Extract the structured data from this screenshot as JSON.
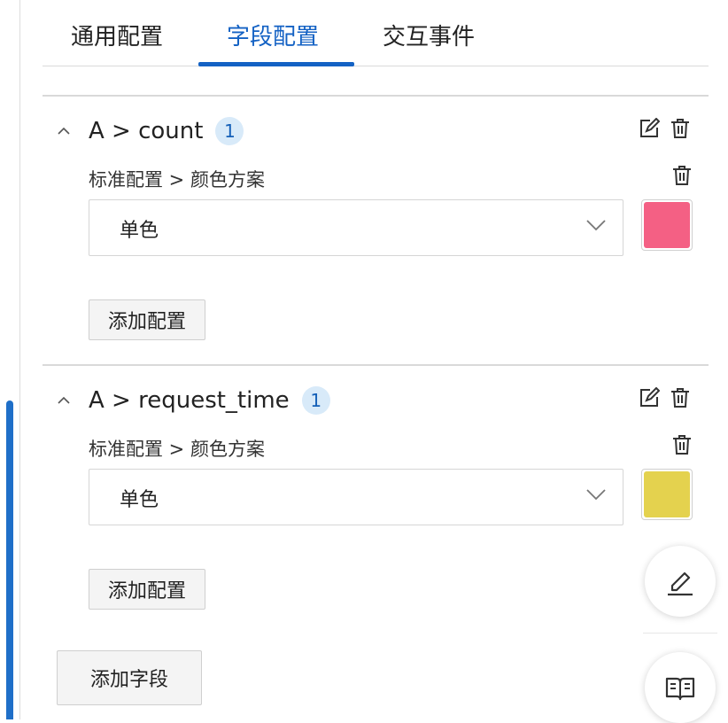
{
  "tabs": [
    {
      "label": "通用配置",
      "active": false
    },
    {
      "label": "字段配置",
      "active": true
    },
    {
      "label": "交互事件",
      "active": false
    }
  ],
  "fields": [
    {
      "title": "A > count",
      "badge": "1",
      "sub_label": "标准配置 > 颜色方案",
      "select_value": "单色",
      "swatch_color": "#f46084",
      "add_config_label": "添加配置"
    },
    {
      "title": "A > request_time",
      "badge": "1",
      "sub_label": "标准配置 > 颜色方案",
      "select_value": "单色",
      "swatch_color": "#e4d24e",
      "add_config_label": "添加配置"
    }
  ],
  "add_field_label": "添加字段",
  "colors": {
    "accent": "#1462c4",
    "badge_bg": "#d8eaf9"
  },
  "icons": [
    "chevron-up-icon",
    "edit-icon",
    "trash-icon",
    "chevron-down-icon",
    "pencil-icon",
    "book-icon"
  ]
}
